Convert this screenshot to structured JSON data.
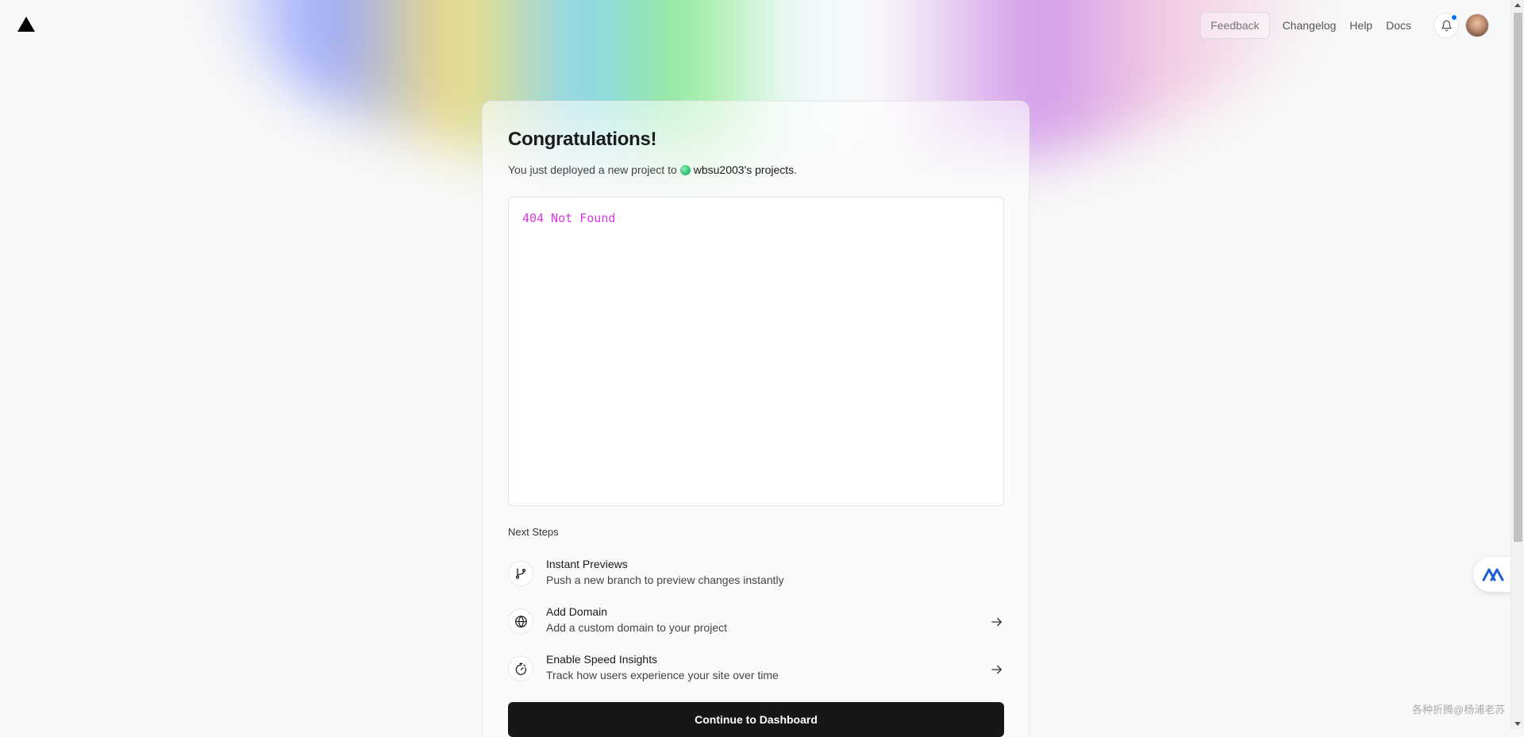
{
  "header": {
    "feedback_label": "Feedback",
    "links": {
      "changelog": "Changelog",
      "help": "Help",
      "docs": "Docs"
    }
  },
  "card": {
    "title": "Congratulations!",
    "subtitle_prefix": "You just deployed a new project to",
    "team_name": "wbsu2003's projects",
    "subtitle_suffix": ".",
    "preview_text": "404 Not Found",
    "next_steps_title": "Next Steps",
    "steps": [
      {
        "title": "Instant Previews",
        "description": "Push a new branch to preview changes instantly",
        "icon": "git-branch-icon"
      },
      {
        "title": "Add Domain",
        "description": "Add a custom domain to your project",
        "icon": "globe-icon"
      },
      {
        "title": "Enable Speed Insights",
        "description": "Track how users experience your site over time",
        "icon": "speed-insights-icon"
      }
    ],
    "continue_label": "Continue to Dashboard"
  },
  "watermark": "各种折腾@杨浦老苏",
  "colors": {
    "preview_text": "#d63ae0",
    "notification_dot": "#0070f3",
    "button_bg": "#171717"
  }
}
